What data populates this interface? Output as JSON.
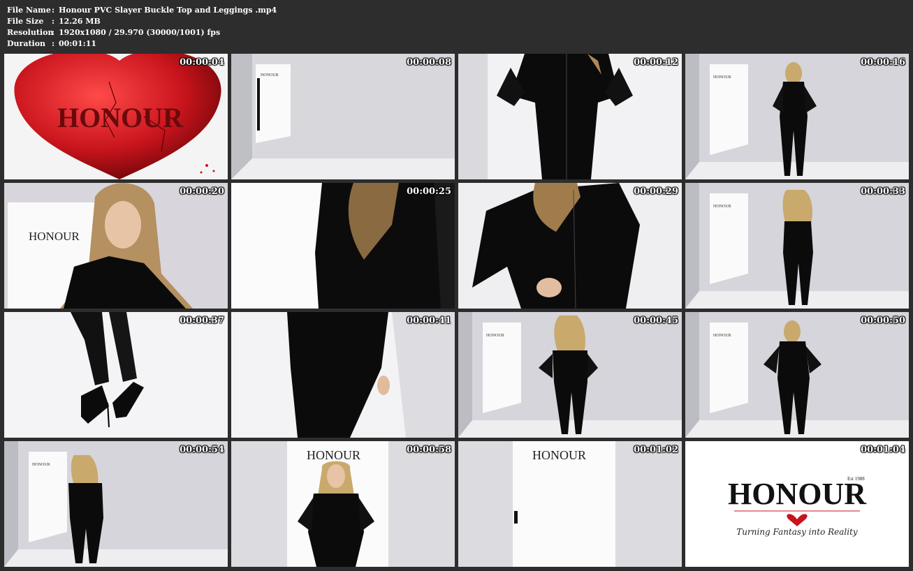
{
  "header": {
    "file_name": {
      "label": "File Name",
      "value": "Honour PVC Slayer Buckle Top and Leggings .mp4"
    },
    "file_size": {
      "label": "File Size",
      "value": "12.26 MB"
    },
    "resolution": {
      "label": "Resolution",
      "value": "1920x1080 / 29.970 (30000/1001) fps"
    },
    "duration": {
      "label": "Duration",
      "value": "00:01:11"
    },
    "separator": ":"
  },
  "thumbnails": [
    {
      "timestamp": "00:00:04"
    },
    {
      "timestamp": "00:00:08"
    },
    {
      "timestamp": "00:00:12"
    },
    {
      "timestamp": "00:00:16"
    },
    {
      "timestamp": "00:00:20"
    },
    {
      "timestamp": "00:00:25"
    },
    {
      "timestamp": "00:00:29"
    },
    {
      "timestamp": "00:00:33"
    },
    {
      "timestamp": "00:00:37"
    },
    {
      "timestamp": "00:00:41"
    },
    {
      "timestamp": "00:00:45"
    },
    {
      "timestamp": "00:00:50"
    },
    {
      "timestamp": "00:00:54"
    },
    {
      "timestamp": "00:00:58"
    },
    {
      "timestamp": "00:01:02"
    },
    {
      "timestamp": "00:01:04"
    }
  ],
  "brand": {
    "word": "HONOUR",
    "word_small": "HONOUR",
    "est": "Est 1988",
    "tagline": "Turning Fantasy into Reality"
  },
  "colors": {
    "background": "#2d2d2d",
    "heart_red": "#c8141c",
    "vinyl_black": "#0b0b0b",
    "studio_white": "#ececf0"
  }
}
